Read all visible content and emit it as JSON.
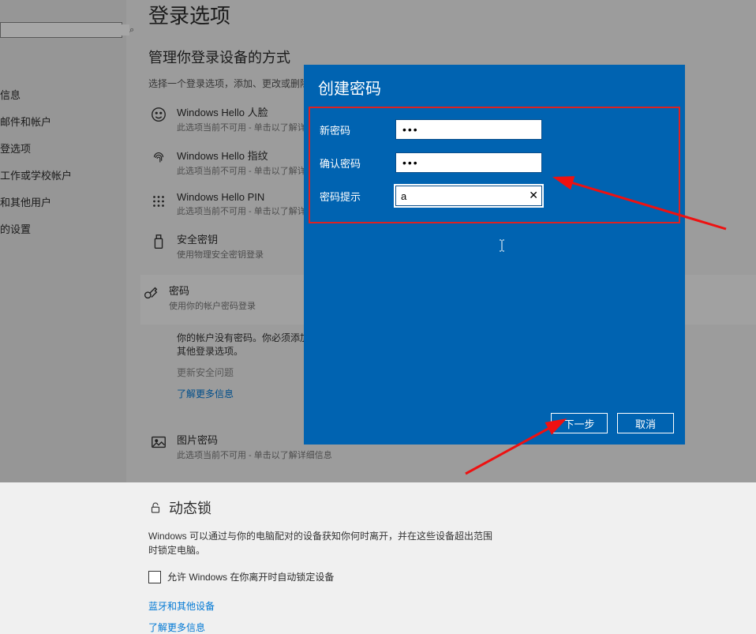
{
  "sidebar": {
    "search_placeholder": "",
    "items": [
      {
        "label": "信息"
      },
      {
        "label": "邮件和帐户"
      },
      {
        "label": "登选项"
      },
      {
        "label": "工作或学校帐户"
      },
      {
        "label": "和其他用户"
      },
      {
        "label": "的设置"
      }
    ]
  },
  "main": {
    "title": "登录选项",
    "subtitle": "管理你登录设备的方式",
    "hint": "选择一个登录选项，添加、更改或删除它。",
    "options": [
      {
        "icon": "face",
        "title": "Windows Hello 人脸",
        "desc": "此选项当前不可用 - 单击以了解详细信息"
      },
      {
        "icon": "fingerprint",
        "title": "Windows Hello 指纹",
        "desc": "此选项当前不可用 - 单击以了解详细信息"
      },
      {
        "icon": "pin",
        "title": "Windows Hello PIN",
        "desc": "此选项当前不可用 - 单击以了解详细信息"
      },
      {
        "icon": "usb",
        "title": "安全密钥",
        "desc": "使用物理安全密钥登录"
      },
      {
        "icon": "key",
        "title": "密码",
        "desc": "使用你的帐户密码登录"
      },
      {
        "icon": "picture",
        "title": "图片密码",
        "desc": "此选项当前不可用 - 单击以了解详细信息"
      }
    ],
    "password_detail": {
      "line1": "你的帐户没有密码。你必须添加一个密码，然后才能使用其他登录选项。",
      "update": "更新安全问题",
      "link": "了解更多信息"
    },
    "dynamic_lock": {
      "title": "动态锁",
      "desc": "Windows 可以通过与你的电脑配对的设备获知你何时离开，并在这些设备超出范围时锁定电脑。",
      "checkbox_label": "允许 Windows 在你离开时自动锁定设备"
    },
    "links": {
      "bluetooth": "蓝牙和其他设备",
      "more": "了解更多信息"
    }
  },
  "dialog": {
    "title": "创建密码",
    "rows": {
      "new_pw_label": "新密码",
      "new_pw_value": "•••",
      "confirm_label": "确认密码",
      "confirm_value": "•••",
      "hint_label": "密码提示",
      "hint_value": "a"
    },
    "buttons": {
      "next": "下一步",
      "cancel": "取消"
    }
  }
}
